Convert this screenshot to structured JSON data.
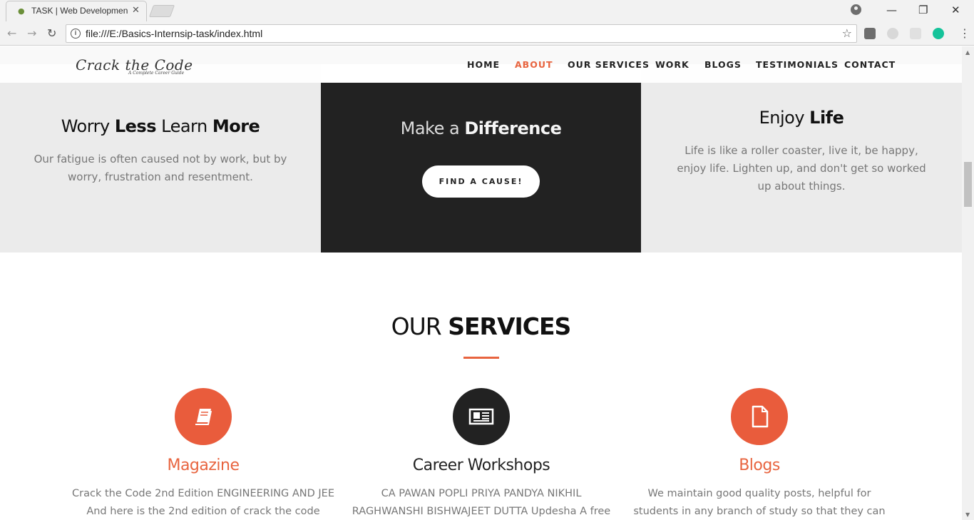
{
  "browser": {
    "tab_title": "TASK | Web Developmen",
    "url": "file:///E:/Basics-Internsip-task/index.html"
  },
  "header": {
    "logo": "Crack the Code",
    "logo_tagline": "A Complete Career Guide",
    "nav": [
      "HOME",
      "ABOUT",
      "OUR SERVICES",
      "WORK",
      "BLOGS",
      "TESTIMONIALS",
      "CONTACT"
    ],
    "active_nav": "ABOUT",
    "accent_color": "#e8643f"
  },
  "promo": {
    "left": {
      "title_parts": [
        "Worry ",
        "Less",
        " Learn ",
        "More"
      ],
      "text_lines": [
        "Our fatigue is often caused not by work, but by",
        "worry, frustration and resentment."
      ]
    },
    "middle": {
      "title_plain": "Make a ",
      "title_bold": "Difference",
      "button": "FIND A CAUSE!"
    },
    "right": {
      "title_plain": "Enjoy ",
      "title_bold": "Life",
      "text_lines": [
        "Life is like a roller coaster, live it, be happy,",
        "enjoy life. Lighten up, and don't get so worked",
        "up about things."
      ]
    }
  },
  "services": {
    "title_plain": "OUR ",
    "title_bold": "SERVICES",
    "items": [
      {
        "icon": "book-icon",
        "heading": "Magazine",
        "text_lines": [
          "Crack the Code 2nd Edition ENGINEERING AND JEE",
          "And here is the 2nd edition of crack the code"
        ]
      },
      {
        "icon": "newspaper-icon",
        "heading": "Career Workshops",
        "text_lines": [
          "CA PAWAN POPLI PRIYA PANDYA NIKHIL",
          "RAGHWANSHI BISHWAJEET DUTTA Updesha A free"
        ]
      },
      {
        "icon": "document-icon",
        "heading": "Blogs",
        "text_lines": [
          "We maintain good quality posts, helpful for",
          "students in any branch of study so that they can"
        ]
      }
    ]
  }
}
